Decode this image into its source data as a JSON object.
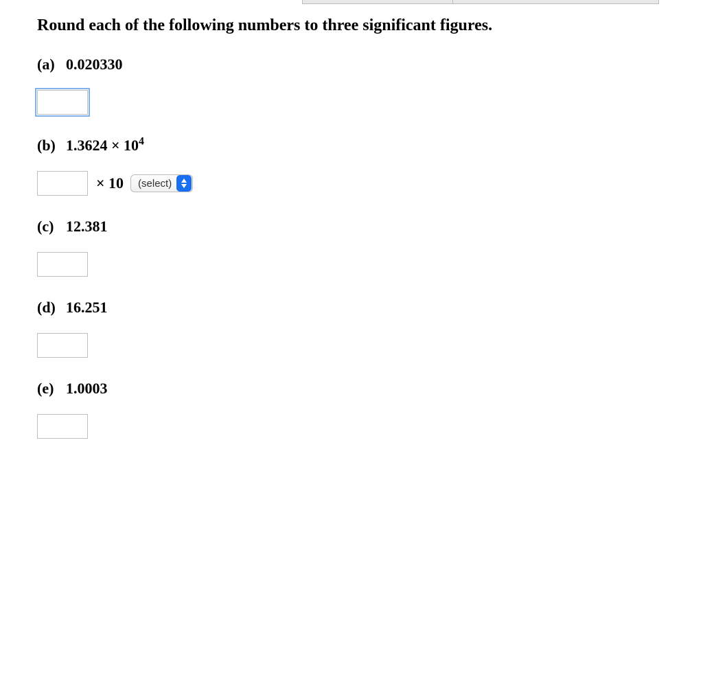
{
  "instruction": "Round each of the following numbers to three significant figures.",
  "parts": {
    "a": {
      "marker": "(a)",
      "value": "0.020330",
      "answer": ""
    },
    "b": {
      "marker": "(b)",
      "value_prefix": "1.3624 × 10",
      "value_exp": "4",
      "answer": "",
      "times10": "× 10",
      "select_placeholder": "(select)"
    },
    "c": {
      "marker": "(c)",
      "value": "12.381",
      "answer": ""
    },
    "d": {
      "marker": "(d)",
      "value": "16.251",
      "answer": ""
    },
    "e": {
      "marker": "(e)",
      "value": "1.0003",
      "answer": ""
    }
  }
}
